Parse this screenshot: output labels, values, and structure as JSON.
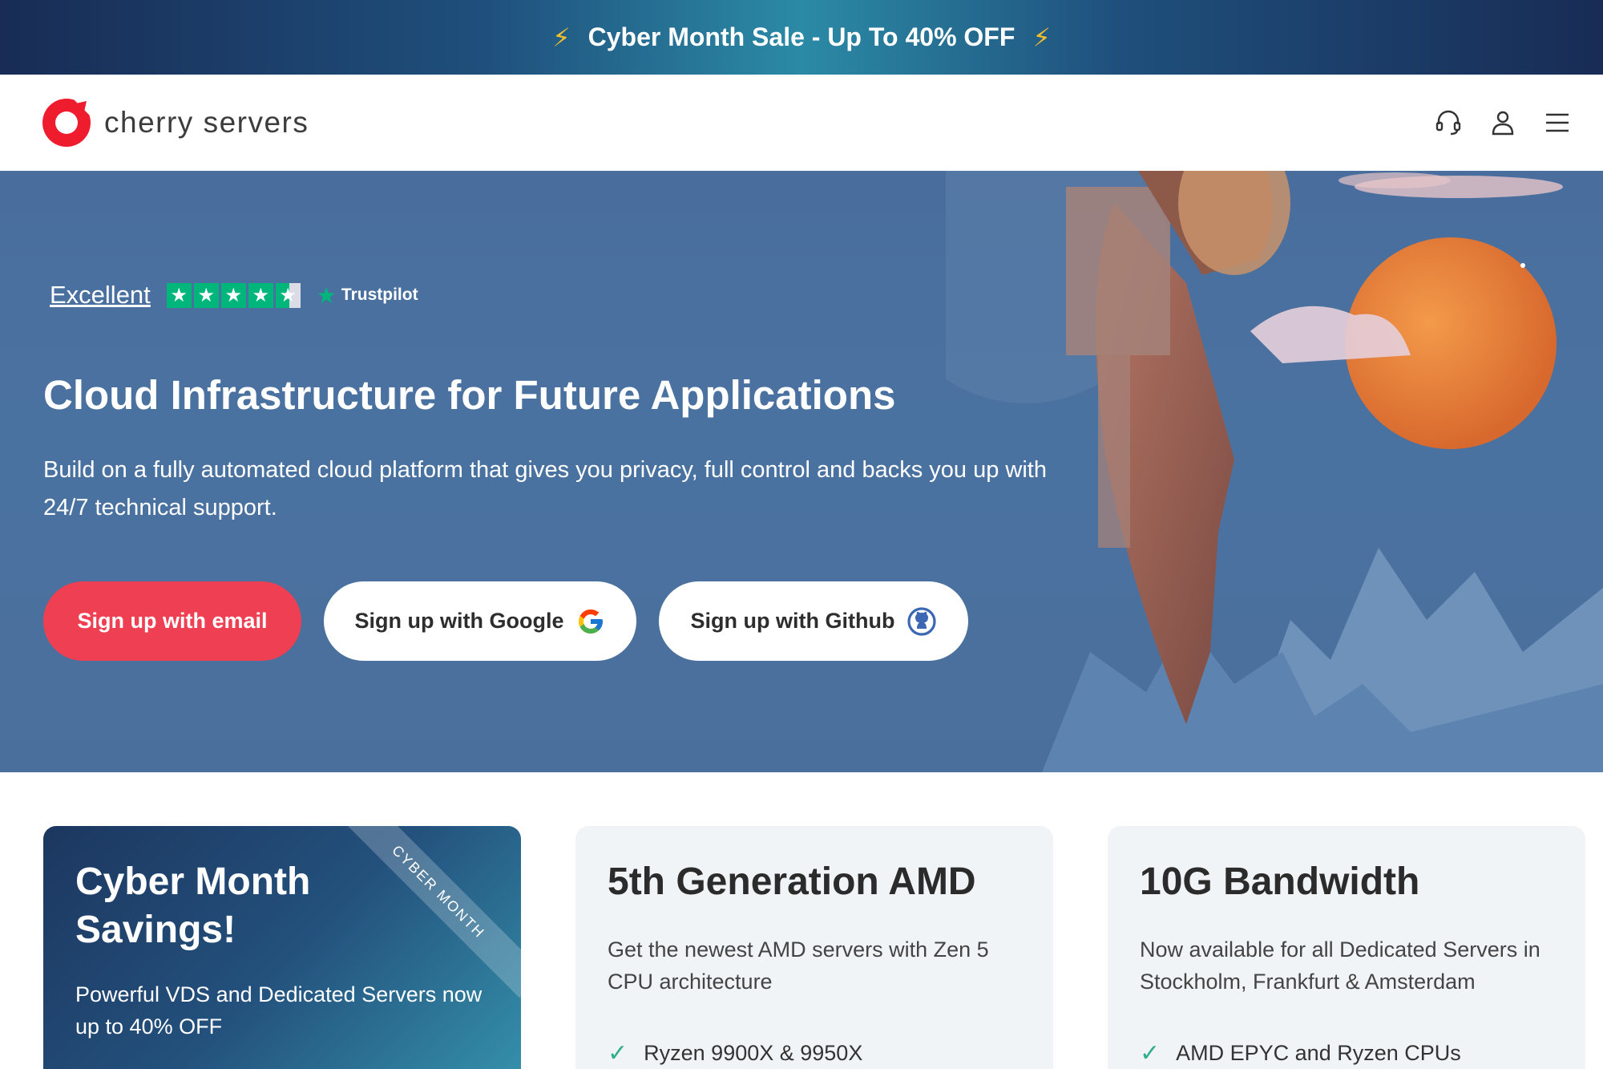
{
  "promo": {
    "text": "Cyber Month Sale - Up To 40% OFF",
    "icon": "lightning-icon",
    "bolt_color": "#f6c02b"
  },
  "header": {
    "logo_text": "cherry servers",
    "icons": [
      "headset-icon",
      "user-icon",
      "menu-icon"
    ],
    "brand_color": "#ef3f52"
  },
  "hero": {
    "rating_label": "Excellent",
    "rating_stars": 4.5,
    "rating_max": 5,
    "trustpilot": "Trustpilot",
    "title": "Cloud Infrastructure for Future Applications",
    "subtitle": "Build on a fully automated cloud platform that gives you privacy, full control and backs you up with 24/7 technical support.",
    "buttons": {
      "email": "Sign up with email",
      "google": "Sign up with Google",
      "github": "Sign up with Github"
    },
    "background_color": "#4a72a0"
  },
  "cards": [
    {
      "title": "Cyber Month Savings!",
      "text": "Powerful VDS and Dedicated Servers now up to 40% OFF",
      "ribbon": "CYBER MONTH"
    },
    {
      "title": "5th Generation AMD",
      "text": "Get the newest AMD servers with Zen 5 CPU architecture",
      "feature": "Ryzen 9900X & 9950X"
    },
    {
      "title": "10G Bandwidth",
      "text": "Now available for all Dedicated Servers in Stockholm, Frankfurt & Amsterdam",
      "feature": "AMD EPYC and Ryzen CPUs"
    }
  ]
}
